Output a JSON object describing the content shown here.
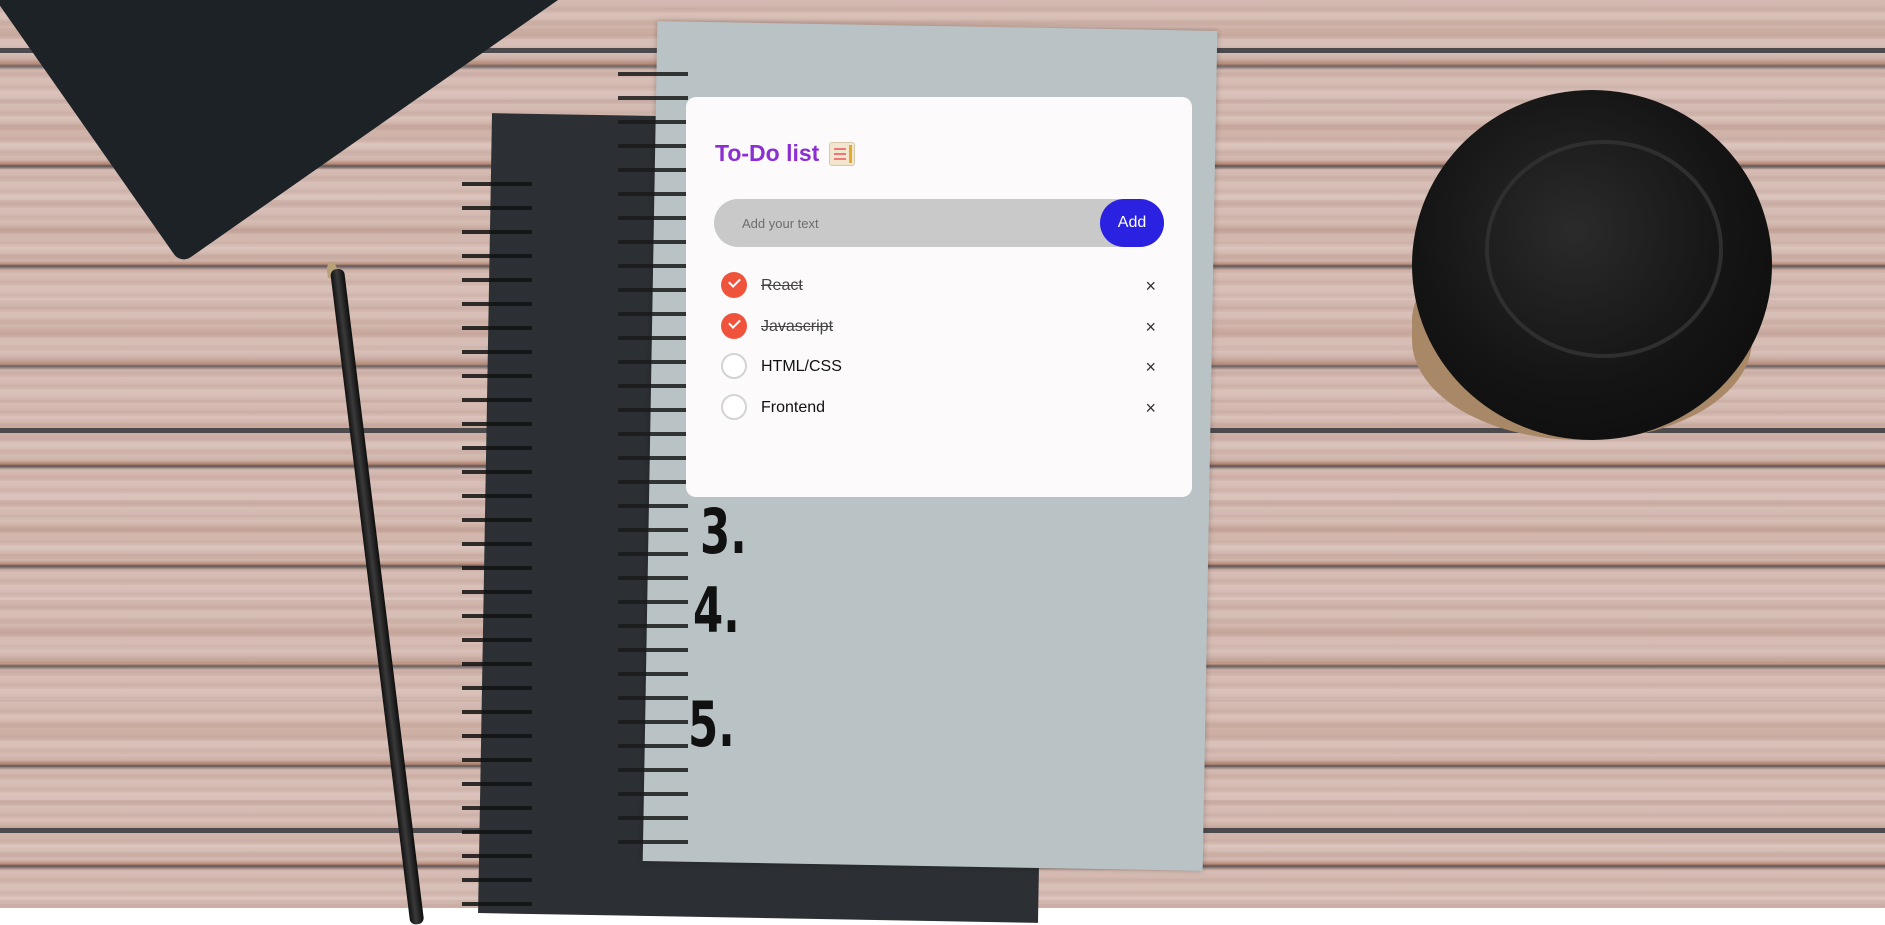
{
  "app": {
    "title": "To-Do list",
    "title_icon": "clipboard-list-icon",
    "accent_color": "#8b2fd3"
  },
  "input": {
    "placeholder": "Add your text",
    "value": "",
    "add_label": "Add",
    "add_color": "#2a22e0"
  },
  "todos": [
    {
      "label": "React",
      "checked": true,
      "remove": "×"
    },
    {
      "label": "Javascript",
      "checked": true,
      "remove": "×"
    },
    {
      "label": "HTML/CSS",
      "checked": false,
      "remove": "×"
    },
    {
      "label": "Frontend",
      "checked": false,
      "remove": "×"
    }
  ],
  "background": {
    "notebook_numbers": [
      "3.",
      "4.",
      "5."
    ]
  }
}
